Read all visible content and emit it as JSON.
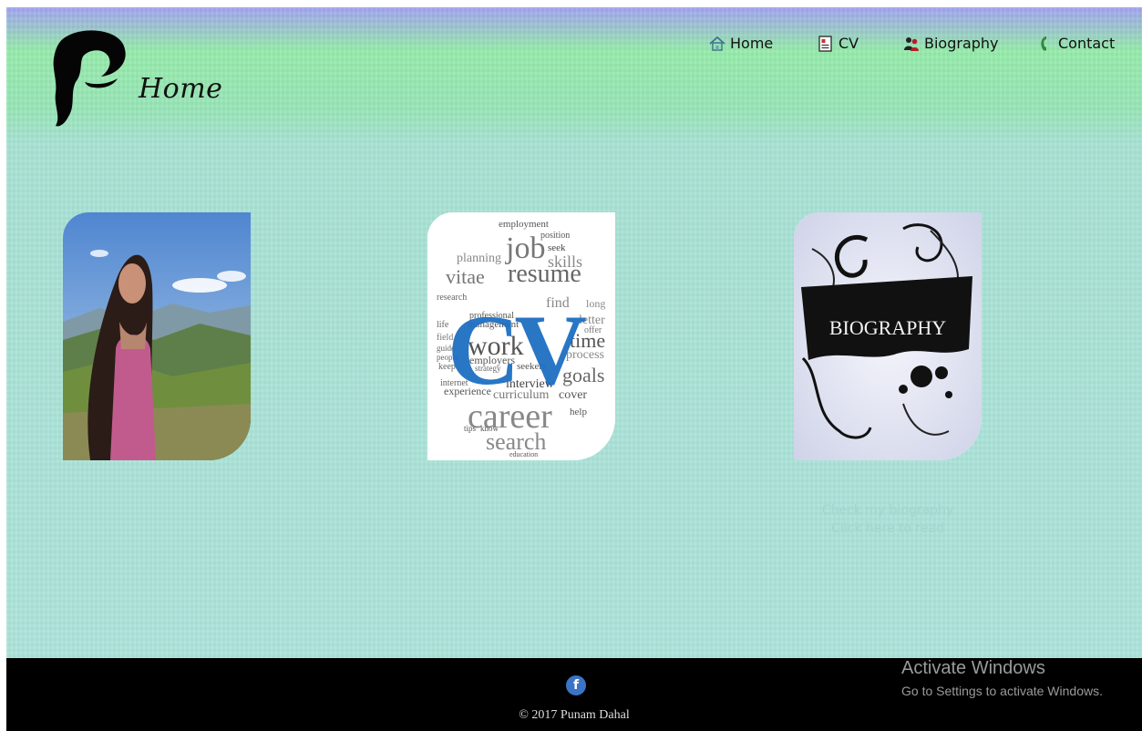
{
  "header": {
    "page_title": "Home",
    "logo_letter": "P"
  },
  "nav": {
    "items": [
      {
        "label": "Home",
        "icon": "home-icon"
      },
      {
        "label": "CV",
        "icon": "document-icon"
      },
      {
        "label": "Biography",
        "icon": "people-icon"
      },
      {
        "label": "Contact",
        "icon": "phone-icon"
      }
    ]
  },
  "cards": {
    "profile": {
      "icon": "profile-photo"
    },
    "cv": {
      "main": "CV",
      "words": [
        "employment",
        "position",
        "job",
        "skills",
        "resume",
        "vitae",
        "planning",
        "seek",
        "find",
        "letter",
        "long",
        "work",
        "time",
        "process",
        "employers",
        "goals",
        "interview",
        "cover",
        "curriculum",
        "career",
        "search",
        "help",
        "experience",
        "internet",
        "keep",
        "people",
        "life",
        "field",
        "research",
        "management",
        "professional",
        "strategy",
        "seekers",
        "offer",
        "guide",
        "tips",
        "know",
        "education"
      ]
    },
    "biography": {
      "label": "BIOGRAPHY",
      "tooltip_line1": "Check my biography",
      "tooltip_line2": "Click here to read"
    }
  },
  "footer": {
    "facebook_icon": "f",
    "copyright": "© 2017 Punam Dahal"
  },
  "watermark": {
    "title": "Activate Windows",
    "subtitle": "Go to Settings to activate Windows."
  },
  "colors": {
    "header_top": "#a2a4f0",
    "header_green": "#96ecaa",
    "body_bg": "#aee4dc",
    "footer_bg": "#000000",
    "cv_blue": "#1e6fc2",
    "facebook": "#3b74c6"
  }
}
